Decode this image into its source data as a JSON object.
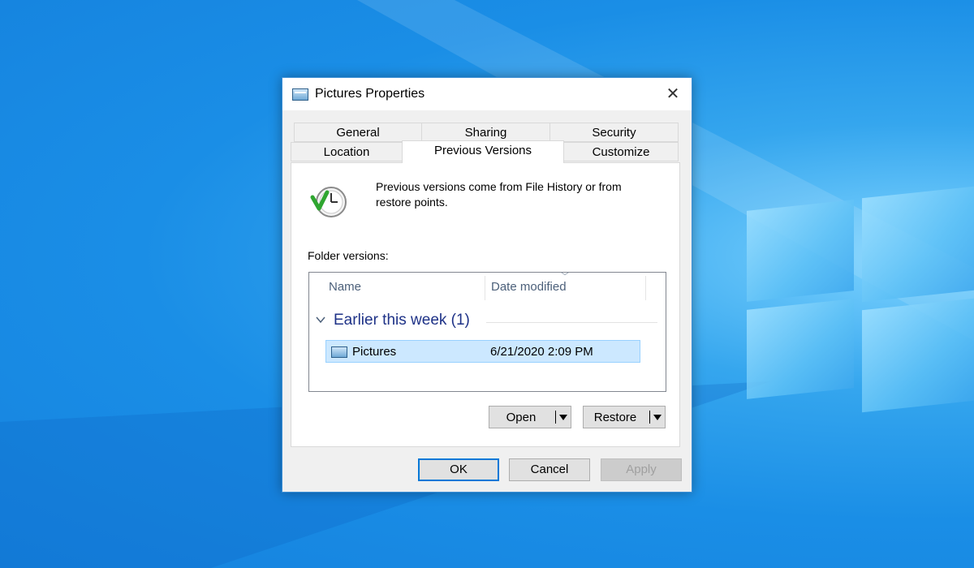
{
  "dialog": {
    "title": "Pictures Properties",
    "close_glyph": "✕",
    "tabs_row1": [
      "General",
      "Sharing",
      "Security"
    ],
    "tabs_row2": [
      "Location",
      "Previous Versions",
      "Customize"
    ],
    "active_tab": "Previous Versions",
    "intro_text": "Previous versions come from File History or from restore points.",
    "folder_versions_label": "Folder versions:",
    "columns": {
      "name": "Name",
      "date_modified": "Date modified"
    },
    "groups": [
      {
        "title": "Earlier this week (1)",
        "items": [
          {
            "name": "Pictures",
            "date": "6/21/2020 2:09 PM",
            "icon": "folder-icon",
            "selected": true
          }
        ]
      }
    ],
    "actions": {
      "open": "Open",
      "restore": "Restore"
    },
    "buttons": {
      "ok": "OK",
      "cancel": "Cancel",
      "apply": "Apply"
    }
  },
  "colors": {
    "desktop": "#1a8ee6",
    "accent": "#0078d7",
    "selection": "#cce8ff",
    "group_title": "#1e3287"
  }
}
